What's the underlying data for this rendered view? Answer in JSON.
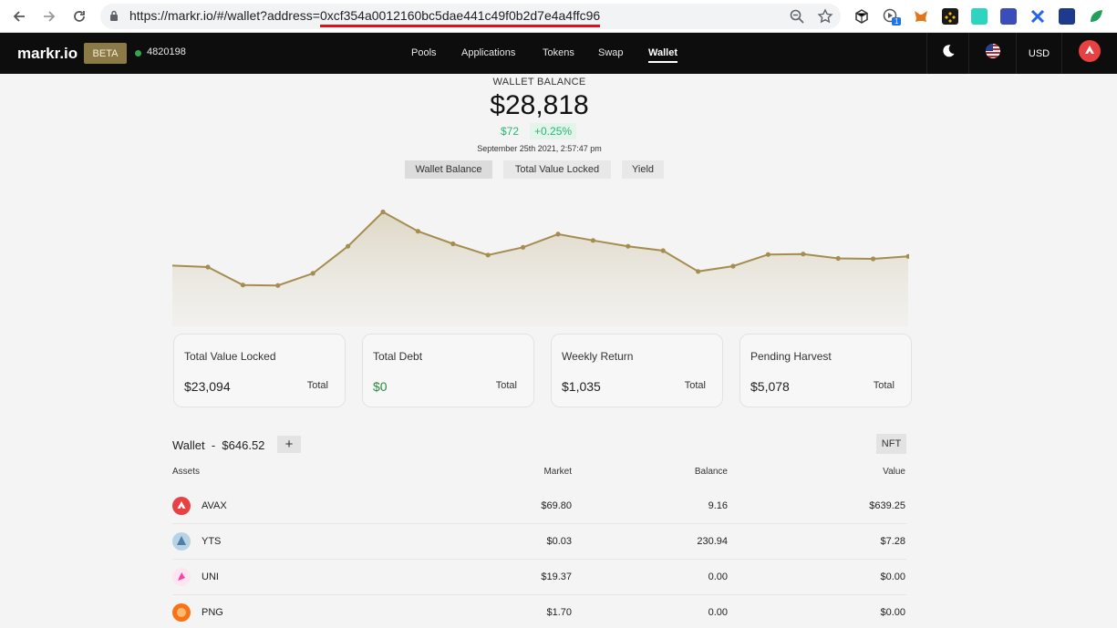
{
  "browser": {
    "url_prefix": "https://markr.io/#/wallet?address=",
    "url_address": "0xcf354a0012160bc5dae441c49f0b2d7e4a4ffc96",
    "extension_badge": "1"
  },
  "header": {
    "logo": "markr.io",
    "beta": "BETA",
    "block_number": "4820198",
    "nav": [
      "Pools",
      "Applications",
      "Tokens",
      "Swap",
      "Wallet"
    ],
    "active_nav": "Wallet",
    "currency": "USD"
  },
  "balance": {
    "label": "WALLET BALANCE",
    "value": "$28,818",
    "change": "$72",
    "change_pct": "+0.25%",
    "date": "September 25th 2021, 2:57:47 pm"
  },
  "tabs": [
    "Wallet Balance",
    "Total Value Locked",
    "Yield"
  ],
  "chart_data": {
    "type": "area",
    "x": [
      1,
      2,
      3,
      4,
      5,
      6,
      7,
      8,
      9,
      10,
      11,
      12,
      13,
      14,
      15,
      16,
      17,
      18,
      19,
      20,
      21,
      22
    ],
    "values": [
      28.96,
      28.93,
      28.56,
      28.55,
      28.8,
      29.36,
      30.07,
      29.67,
      29.41,
      29.18,
      29.34,
      29.61,
      29.48,
      29.36,
      29.27,
      28.84,
      28.95,
      29.19,
      29.2,
      29.11,
      29.1,
      29.15
    ],
    "color": "#a58d4f"
  },
  "cards": [
    {
      "title": "Total Value Locked",
      "value": "$23,094",
      "total": "Total"
    },
    {
      "title": "Total Debt",
      "value": "$0",
      "total": "Total"
    },
    {
      "title": "Weekly Return",
      "value": "$1,035",
      "total": "Total"
    },
    {
      "title": "Pending Harvest",
      "value": "$5,078",
      "total": "Total"
    }
  ],
  "wallet": {
    "title": "Wallet  -  $646.52",
    "plus": "+",
    "nft": "NFT",
    "columns": [
      "Assets",
      "Market",
      "Balance",
      "Value"
    ],
    "rows": [
      {
        "asset": "AVAX",
        "market": "$69.80",
        "balance": "9.16",
        "value": "$639.25",
        "color": "#e84142"
      },
      {
        "asset": "YTS",
        "market": "$0.03",
        "balance": "230.94",
        "value": "$7.28",
        "color": "#8fb7d6"
      },
      {
        "asset": "UNI",
        "market": "$19.37",
        "balance": "0.00",
        "value": "$0.00",
        "color": "#ff3fa4"
      },
      {
        "asset": "PNG",
        "market": "$1.70",
        "balance": "0.00",
        "value": "$0.00",
        "color": "#f97316"
      }
    ]
  }
}
